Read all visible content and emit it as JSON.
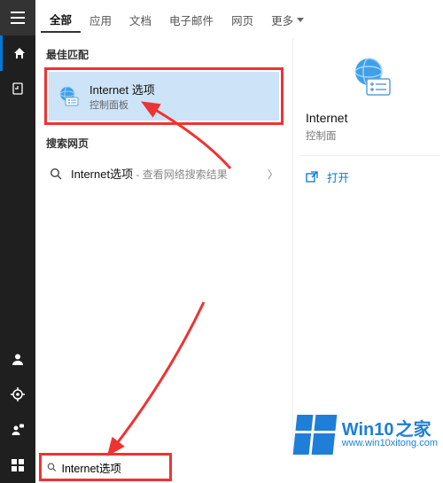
{
  "tabs": {
    "all": "全部",
    "apps": "应用",
    "documents": "文档",
    "emails": "电子邮件",
    "web": "网页",
    "more": "更多"
  },
  "sections": {
    "best_match": "最佳匹配",
    "search_web": "搜索网页"
  },
  "best_match": {
    "title": "Internet 选项",
    "subtitle": "控制面板"
  },
  "web_search": {
    "query": "Internet选项",
    "hint": " - 查看网络搜索结果"
  },
  "preview": {
    "title": "Internet",
    "subtitle": "控制面"
  },
  "actions": {
    "open": "打开"
  },
  "search_input": {
    "value": "Internet选项",
    "placeholder": ""
  },
  "watermark": {
    "brand_en": "Win10",
    "brand_zh": "之家",
    "url": "www.win10xitong.com"
  },
  "colors": {
    "accent": "#0078d7",
    "highlight_bg": "#cde3f8",
    "annotation": "#e33"
  }
}
